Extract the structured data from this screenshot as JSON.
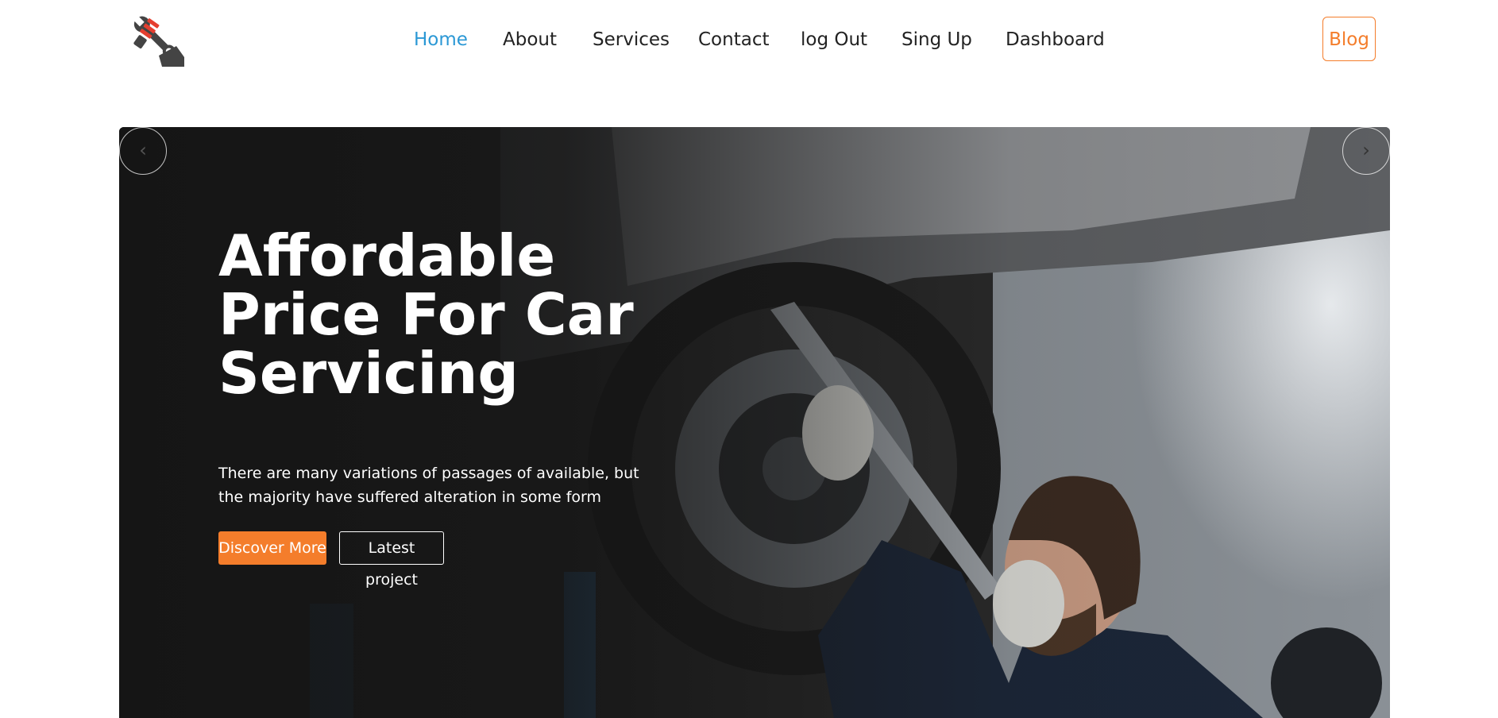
{
  "nav": {
    "logo_icon": "wrench-spark-plug-logo-icon",
    "links": [
      {
        "label": "Home",
        "active": true
      },
      {
        "label": "About",
        "active": false
      },
      {
        "label": "Services",
        "active": false
      },
      {
        "label": "Contact",
        "active": false
      },
      {
        "label": "log Out",
        "active": false
      },
      {
        "label": "Sing Up",
        "active": false
      },
      {
        "label": "Dashboard",
        "active": false
      }
    ],
    "blog_label": "Blog"
  },
  "hero": {
    "title": "Affordable Price For Car Servicing",
    "text": "There are many variations of passages of available, but the majority have suffered alteration in some form",
    "discover_label": "Discover More",
    "latest_label": "Latest project",
    "prev_icon": "‹",
    "next_icon": "›"
  },
  "colors": {
    "accent": "#f47d2b",
    "nav_active": "#2b98d5",
    "nav_text": "#222222",
    "hero_dark": "#1b1b1b"
  }
}
